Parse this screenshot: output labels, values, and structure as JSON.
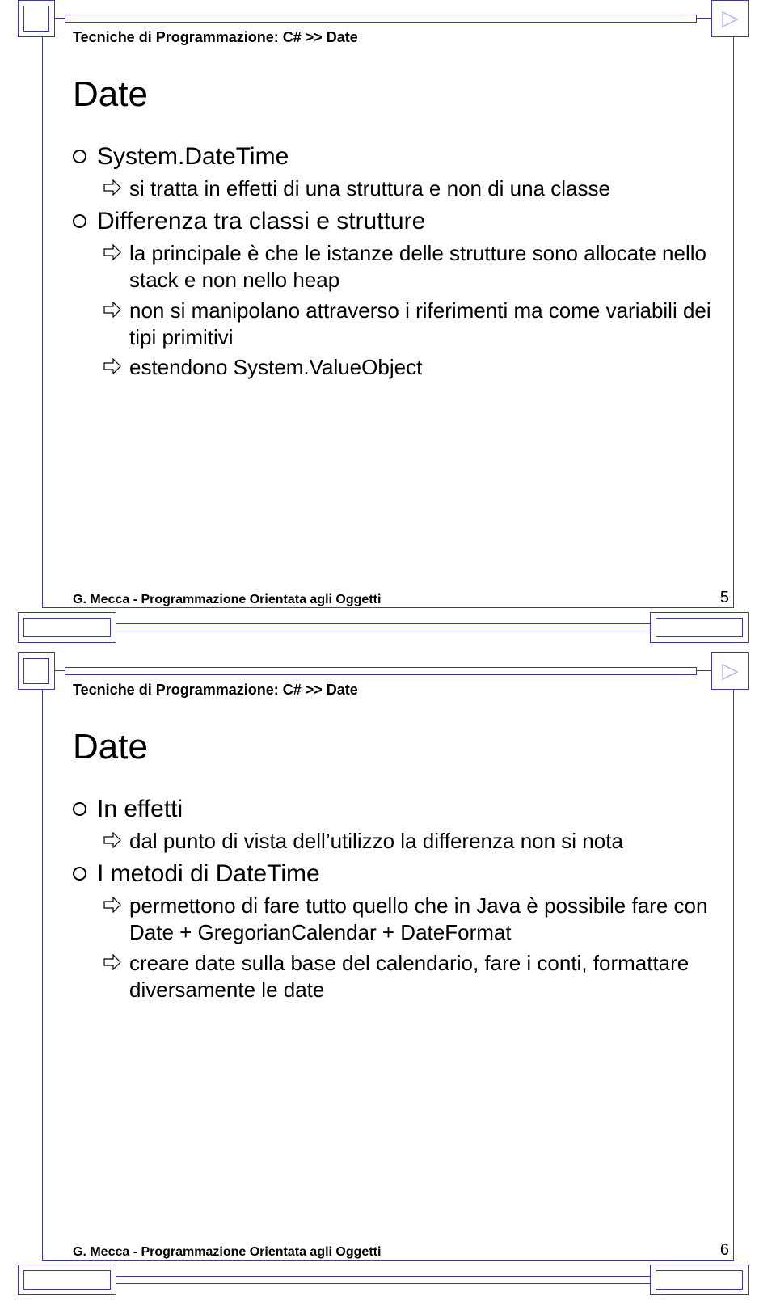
{
  "slides": [
    {
      "header": "Tecniche di Programmazione: C# >> Date",
      "title": "Date",
      "footer": "G. Mecca - Programmazione Orientata agli Oggetti",
      "page": "5",
      "items": [
        {
          "level": 1,
          "text": "System.DateTime"
        },
        {
          "level": 2,
          "text": "si tratta in effetti di una struttura e non di una classe"
        },
        {
          "level": 1,
          "text": "Differenza tra classi e strutture"
        },
        {
          "level": 2,
          "text": "la principale è che le istanze delle strutture sono allocate nello stack e non nello heap"
        },
        {
          "level": 2,
          "text": "non si manipolano attraverso i riferimenti ma come variabili dei tipi primitivi"
        },
        {
          "level": 2,
          "text": "estendono System.ValueObject"
        }
      ]
    },
    {
      "header": "Tecniche di Programmazione: C# >> Date",
      "title": "Date",
      "footer": "G. Mecca - Programmazione Orientata agli Oggetti",
      "page": "6",
      "items": [
        {
          "level": 1,
          "text": "In effetti"
        },
        {
          "level": 2,
          "text": "dal punto di vista dell’utilizzo la differenza non si nota"
        },
        {
          "level": 1,
          "text": "I metodi di DateTime"
        },
        {
          "level": 2,
          "text": "permettono di fare tutto quello che in Java è possibile fare con Date + GregorianCalendar + DateFormat"
        },
        {
          "level": 2,
          "text": "creare date sulla base del calendario, fare i conti, formattare diversamente le date"
        }
      ]
    }
  ]
}
